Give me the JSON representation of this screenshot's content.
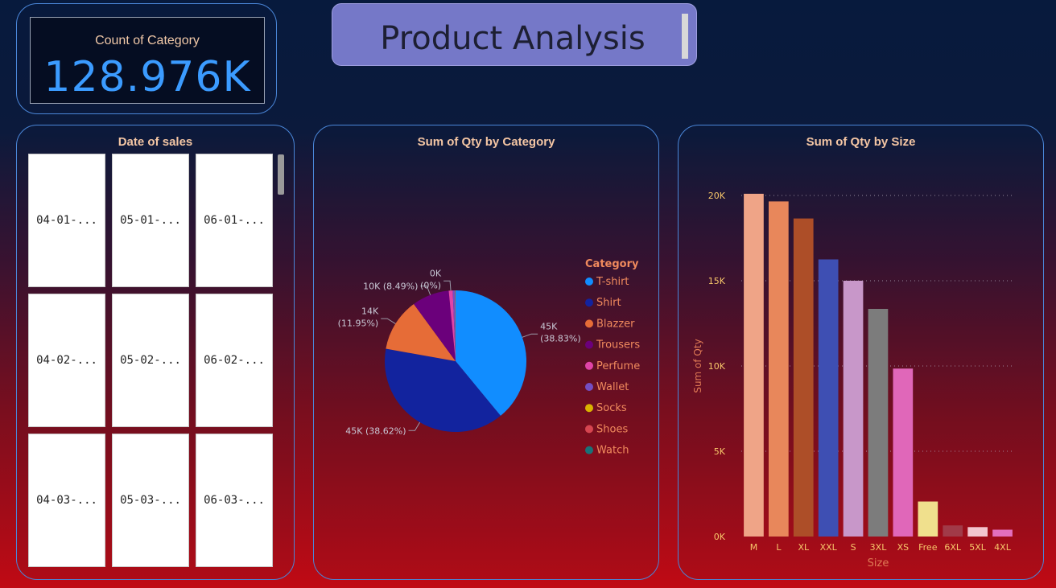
{
  "kpi": {
    "label": "Count of Category",
    "value": "128.976K"
  },
  "header": {
    "title": "Product Analysis"
  },
  "dates": {
    "title": "Date of sales",
    "tiles": [
      "04-01-...",
      "05-01-...",
      "06-01-...",
      "04-02-...",
      "05-02-...",
      "06-02-...",
      "04-03-...",
      "05-03-...",
      "06-03-..."
    ]
  },
  "pie": {
    "title": "Sum of Qty by Category",
    "legend_title": "Category",
    "legend": [
      "T-shirt",
      "Shirt",
      "Blazzer",
      "Trousers",
      "Perfume",
      "Wallet",
      "Socks",
      "Shoes",
      "Watch"
    ]
  },
  "bars": {
    "title": "Sum of Qty by Size",
    "xlabel": "Size",
    "ylabel": "Sum of Qty"
  },
  "chart_data": [
    {
      "type": "pie",
      "title": "Sum of Qty by Category",
      "legend_title": "Category",
      "legend_position": "right",
      "categories": [
        "T-shirt",
        "Shirt",
        "Blazzer",
        "Trousers",
        "Perfume",
        "Wallet",
        "Socks",
        "Shoes",
        "Watch"
      ],
      "values": [
        45000,
        44700,
        14000,
        9800,
        1050,
        600,
        100,
        30,
        3
      ],
      "colors": [
        "#118dff",
        "#12239e",
        "#e66c37",
        "#6b007b",
        "#e044a7",
        "#744ec2",
        "#d9b300",
        "#d64550",
        "#197278"
      ],
      "data_labels": [
        {
          "category": "T-shirt",
          "text": [
            "45K",
            "(38.83%)"
          ]
        },
        {
          "category": "Shirt",
          "text": [
            "45K (38.62%)"
          ]
        },
        {
          "category": "Blazzer",
          "text": [
            "14K",
            "(11.95%)"
          ]
        },
        {
          "category": "Trousers",
          "text": [
            "10K (8.49%)"
          ]
        },
        {
          "category": "Perfume",
          "text": [
            "0K",
            "(0%)"
          ]
        }
      ]
    },
    {
      "type": "bar",
      "title": "Sum of Qty by Size",
      "xlabel": "Size",
      "ylabel": "Sum of Qty",
      "categories": [
        "M",
        "L",
        "XL",
        "XXL",
        "S",
        "3XL",
        "XS",
        "Free",
        "6XL",
        "5XL",
        "4XL"
      ],
      "values": [
        20100,
        19650,
        18650,
        16250,
        15000,
        13350,
        9850,
        2050,
        650,
        550,
        400
      ],
      "colors": [
        "#efa487",
        "#e8875b",
        "#ad4e28",
        "#3e4fb3",
        "#c897c9",
        "#7c7c7c",
        "#e067b9",
        "#f0e08d",
        "#a13a48",
        "#f3c5cf",
        "#e36fbd"
      ],
      "ylim": [
        0,
        20000
      ],
      "yticks": [
        "0K",
        "5K",
        "10K",
        "15K",
        "20K"
      ],
      "grid": true
    }
  ],
  "colors": {
    "accent_blue": "#3b9bff",
    "card_border": "#4a86d8",
    "title_text": "#f4c6a4",
    "legend_title": "#f08a5d",
    "axis_text": "#f7c76a"
  }
}
